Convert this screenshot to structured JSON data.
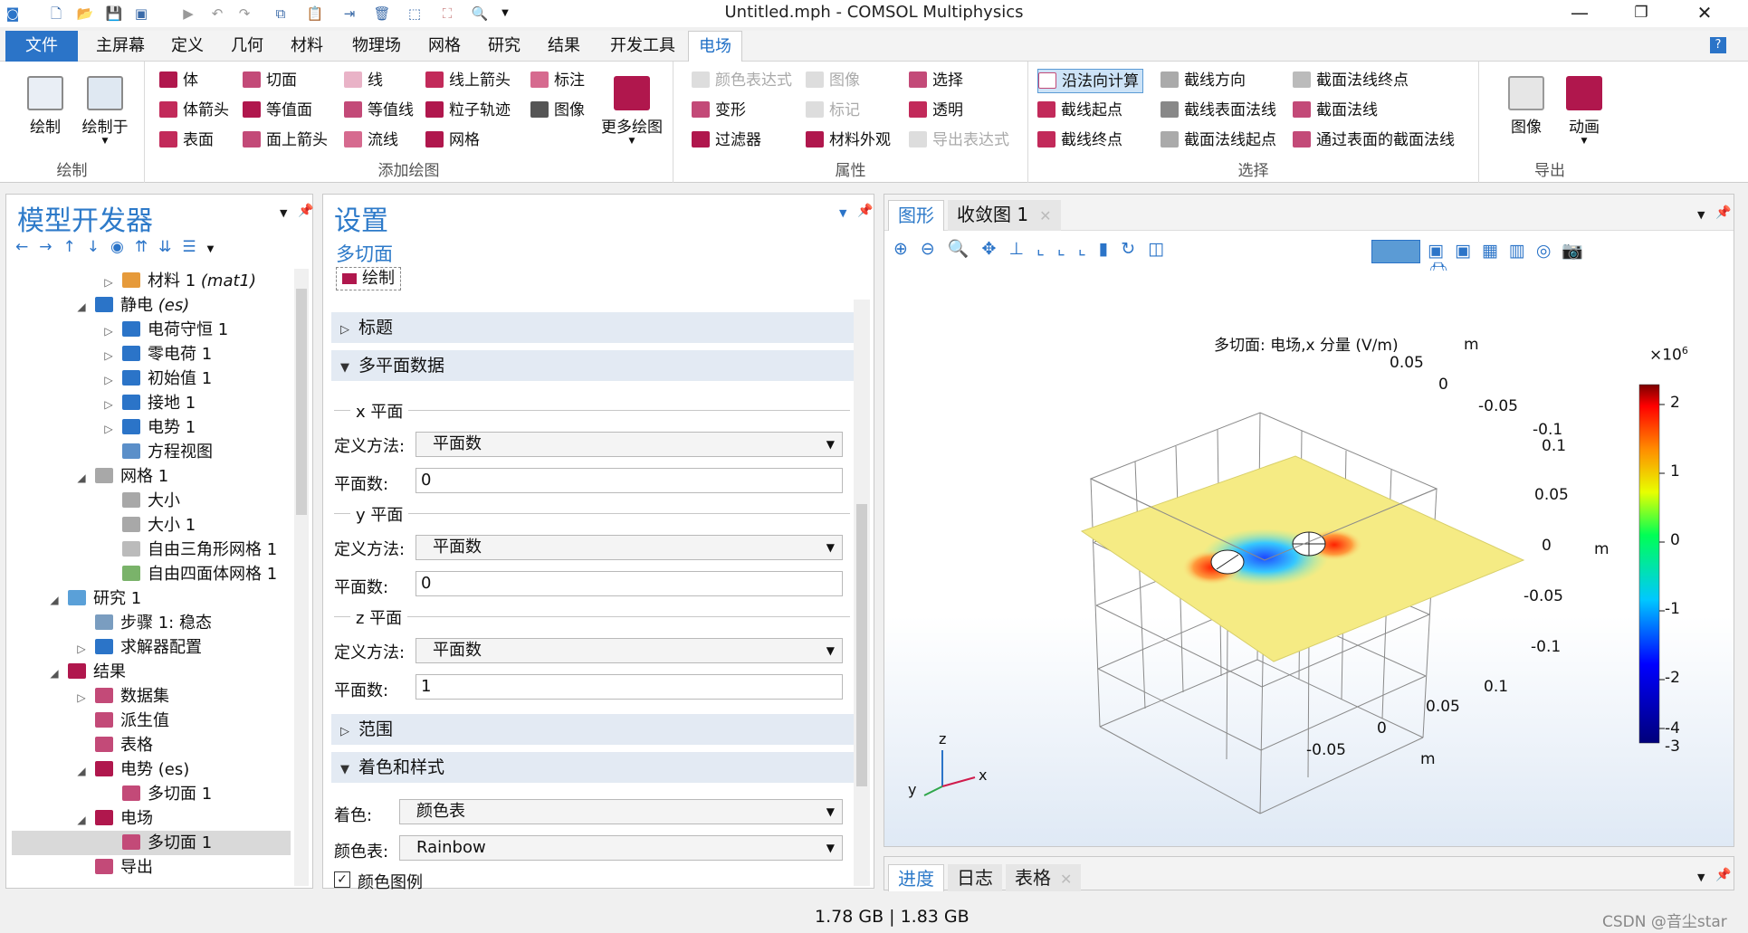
{
  "window": {
    "title": "Untitled.mph - COMSOL Multiphysics",
    "minimize": "—",
    "maximize": "❐",
    "close": "✕"
  },
  "menu": {
    "file": "文件",
    "tabs": [
      "主屏幕",
      "定义",
      "几何",
      "材料",
      "物理场",
      "网格",
      "研究",
      "结果",
      "开发工具",
      "电场"
    ],
    "help": "?"
  },
  "ribbon": {
    "group_draw": {
      "label": "绘制",
      "draw": "绘制",
      "draw_in": "绘制于"
    },
    "group_add": {
      "label": "添加绘图",
      "items": [
        "体",
        "切面",
        "线",
        "线上箭头",
        "标注",
        "体箭头",
        "等值面",
        "等值线",
        "粒子轨迹",
        "图像",
        "表面",
        "面上箭头",
        "流线",
        "网格"
      ],
      "more": "更多绘图"
    },
    "group_attr": {
      "label": "属性",
      "items": [
        "颜色表达式",
        "图像",
        "选择",
        "变形",
        "标记",
        "透明",
        "过滤器",
        "材料外观",
        "导出表达式"
      ]
    },
    "group_sel": {
      "label": "选择",
      "items": [
        "沿法向计算",
        "截线方向",
        "截面法线终点",
        "截线起点",
        "截线表面法线",
        "截面法线",
        "截线终点",
        "截面法线起点",
        "通过表面的截面法线"
      ]
    },
    "group_export": {
      "label": "导出",
      "image": "图像",
      "animation": "动画"
    }
  },
  "model_builder": {
    "title": "模型开发器",
    "tree": [
      {
        "label": "材料 1 ",
        "tag": "(mat1)"
      },
      {
        "label": "静电 ",
        "tag": "(es)"
      },
      {
        "label": "电荷守恒 1",
        "tag": ""
      },
      {
        "label": "零电荷 1",
        "tag": ""
      },
      {
        "label": "初始值 1",
        "tag": ""
      },
      {
        "label": "接地 1",
        "tag": ""
      },
      {
        "label": "电势 1",
        "tag": ""
      },
      {
        "label": "方程视图",
        "tag": ""
      },
      {
        "label": "网格 1",
        "tag": ""
      },
      {
        "label": "大小",
        "tag": ""
      },
      {
        "label": "大小 1",
        "tag": ""
      },
      {
        "label": "自由三角形网格 1",
        "tag": ""
      },
      {
        "label": "自由四面体网格 1",
        "tag": ""
      },
      {
        "label": "研究 1",
        "tag": ""
      },
      {
        "label": "步骤 1: 稳态",
        "tag": ""
      },
      {
        "label": "求解器配置",
        "tag": ""
      },
      {
        "label": "结果",
        "tag": ""
      },
      {
        "label": "数据集",
        "tag": ""
      },
      {
        "label": "派生值",
        "tag": ""
      },
      {
        "label": "表格",
        "tag": ""
      },
      {
        "label": "电势 (es)",
        "tag": ""
      },
      {
        "label": "多切面 1",
        "tag": ""
      },
      {
        "label": "电场",
        "tag": ""
      },
      {
        "label": "多切面 1",
        "tag": ""
      },
      {
        "label": "导出",
        "tag": ""
      }
    ]
  },
  "settings": {
    "title": "设置",
    "subtitle": "多切面",
    "plot_button": "绘制",
    "sec_title": "标题",
    "sec_multiplane": "多平面数据",
    "x_plane": "x 平面",
    "y_plane": "y 平面",
    "z_plane": "z 平面",
    "method_label": "定义方法:",
    "method_value": "平面数",
    "count_label": "平面数:",
    "x_count": "0",
    "y_count": "0",
    "z_count": "1",
    "sec_range": "范围",
    "sec_coloring": "着色和样式",
    "coloring_label": "着色:",
    "coloring_value": "颜色表",
    "colortable_label": "颜色表:",
    "colortable_value": "Rainbow",
    "legend_check": "颜色图例"
  },
  "graphics": {
    "tab_graphics": "图形",
    "tab_convergence": "收敛图 1",
    "plot_title": "多切面: 电场,x 分量 (V/m)",
    "unit_exp": "×10",
    "unit_sup": "6",
    "legend_ticks": [
      "2",
      "1",
      "0",
      "-1",
      "-2",
      "-3",
      "-4"
    ],
    "axis_m": "m",
    "y_ticks": [
      "0.05",
      "0",
      "-0.05",
      "-0.1"
    ],
    "z_ticks": [
      "0.1",
      "0.05",
      "0",
      "-0.05",
      "-0.1"
    ],
    "x_ticks": [
      "0.1",
      "0.05",
      "0",
      "-0.05"
    ],
    "triad": {
      "z": "z",
      "y": "y",
      "x": "x"
    }
  },
  "bottom_tabs": [
    "进度",
    "日志",
    "表格"
  ],
  "status": {
    "memory": "1.78 GB | 1.83 GB"
  },
  "watermark": "CSDN @音尘star"
}
